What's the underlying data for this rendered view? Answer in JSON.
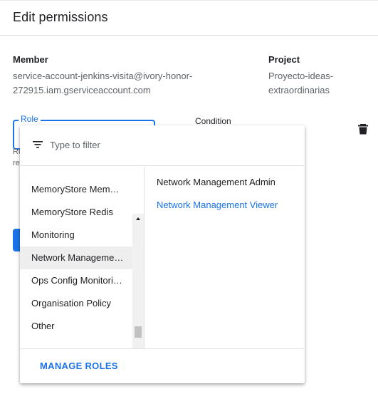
{
  "dialog": {
    "title": "Edit permissions"
  },
  "member": {
    "label": "Member",
    "value_line1": "service-account-jenkins-visita@ivory-honor-",
    "value_line2": "272915.iam.gserviceaccount.com"
  },
  "project": {
    "label": "Project",
    "value_line1": "Proyecto-ideas-",
    "value_line2": "extraordinarias"
  },
  "role": {
    "label": "Role",
    "hint_line1": "Re",
    "hint_line2": "re"
  },
  "condition": {
    "label": "Condition"
  },
  "icons": {
    "delete": "trash-icon",
    "filter": "filter-icon"
  },
  "dropdown": {
    "filter_placeholder": "Type to filter",
    "categories": [
      {
        "label": "MemoryStore Mem…",
        "selected": false
      },
      {
        "label": "MemoryStore Redis",
        "selected": false
      },
      {
        "label": "Monitoring",
        "selected": false
      },
      {
        "label": "Network Manageme…",
        "selected": true
      },
      {
        "label": "Ops Config Monitori…",
        "selected": false
      },
      {
        "label": "Organisation Policy",
        "selected": false
      },
      {
        "label": "Other",
        "selected": false
      }
    ],
    "roles": [
      {
        "label": "Network Management Admin",
        "color": "#202124"
      },
      {
        "label": "Network Management Viewer",
        "color": "#1a73e8"
      }
    ],
    "manage_roles": "MANAGE ROLES"
  },
  "colors": {
    "accent": "#1a73e8",
    "text": "#202124",
    "secondary": "#5f6368"
  }
}
